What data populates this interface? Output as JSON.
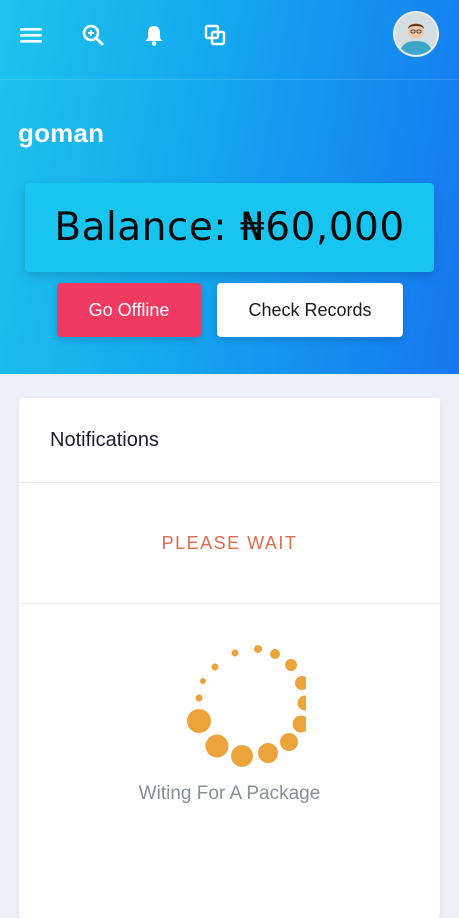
{
  "topbar": {
    "icons": [
      "menu-icon",
      "search-zoom-icon",
      "bell-icon",
      "copy-icon"
    ],
    "avatar": "avatar"
  },
  "user": {
    "name": "goman"
  },
  "balance": {
    "text": "Balance: ₦60,000"
  },
  "actions": {
    "offline_label": "Go Offline",
    "records_label": "Check Records"
  },
  "notifications": {
    "title": "Notifications",
    "status": "PLEASE WAIT",
    "waiting_message": "Witing For A Package"
  },
  "colors": {
    "gradient_start": "#1ec3ec",
    "gradient_end": "#1677f0",
    "balance_card": "#18c4f0",
    "offline_button": "#f03a62",
    "status_text": "#e06a4e",
    "spinner": "#eba43c"
  }
}
